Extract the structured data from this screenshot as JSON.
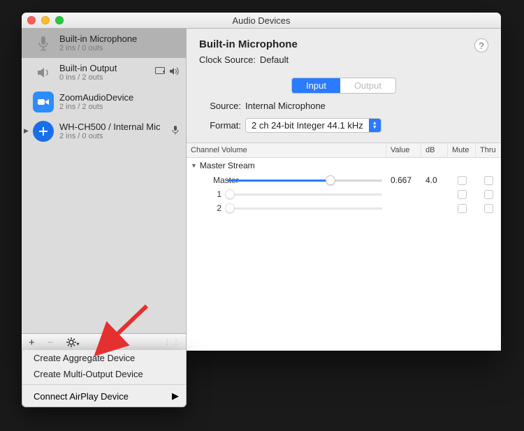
{
  "window": {
    "title": "Audio Devices"
  },
  "sidebar": {
    "devices": [
      {
        "name": "Built-in Microphone",
        "sub": "2 ins / 0 outs",
        "icon": "mic",
        "selected": true,
        "expandable": false,
        "right": []
      },
      {
        "name": "Built-in Output",
        "sub": "0 ins / 2 outs",
        "icon": "speaker",
        "selected": false,
        "expandable": false,
        "right": [
          "display",
          "sound"
        ]
      },
      {
        "name": "ZoomAudioDevice",
        "sub": "2 ins / 2 outs",
        "icon": "zoom",
        "selected": false,
        "expandable": false,
        "right": []
      },
      {
        "name": "WH-CH500 / Internal Mic",
        "sub": "2 ins / 0 outs",
        "icon": "aggregate",
        "selected": false,
        "expandable": true,
        "right": [
          "mic"
        ]
      }
    ],
    "toolbar": {
      "add": "+",
      "remove": "−",
      "gear": "✻"
    }
  },
  "popup": {
    "items": [
      "Create Aggregate Device",
      "Create Multi-Output Device"
    ],
    "submenu": "Connect AirPlay Device"
  },
  "detail": {
    "title": "Built-in Microphone",
    "clockLabel": "Clock Source:",
    "clockValue": "Default",
    "tabs": {
      "input": "Input",
      "output": "Output"
    },
    "sourceLabel": "Source:",
    "sourceValue": "Internal Microphone",
    "formatLabel": "Format:",
    "formatValue": "2 ch 24-bit Integer 44.1 kHz"
  },
  "channels": {
    "headers": [
      "Channel Volume",
      "Value",
      "dB",
      "Mute",
      "Thru"
    ],
    "masterStream": "Master Stream",
    "rows": [
      {
        "name": "Master",
        "fill": 0.667,
        "value": "0.667",
        "db": "4.0",
        "enabled": true
      },
      {
        "name": "1",
        "fill": 0.0,
        "value": "",
        "db": "",
        "enabled": false
      },
      {
        "name": "2",
        "fill": 0.0,
        "value": "",
        "db": "",
        "enabled": false
      }
    ]
  },
  "help": "?"
}
